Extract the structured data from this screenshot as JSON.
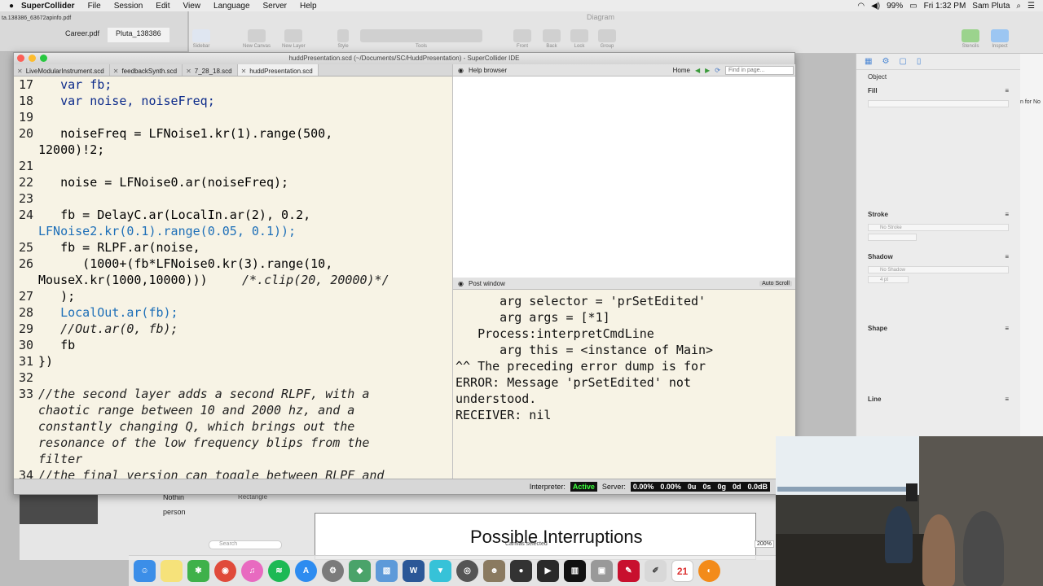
{
  "menubar": {
    "app": "SuperCollider",
    "items": [
      "File",
      "Session",
      "Edit",
      "View",
      "Language",
      "Server",
      "Help"
    ],
    "battery": "99%",
    "clock": "Fri 1:32 PM",
    "user": "Sam Pluta"
  },
  "background": {
    "file_label": "ta.138386_63672apinfo.pdf",
    "tabs": [
      "Career.pdf",
      "Pluta_138386"
    ],
    "diagram_title": "Diagram",
    "tools": [
      "Sidebar",
      "New Canvas",
      "New Layer",
      "Style",
      "Tools",
      "Front",
      "Back",
      "Lock",
      "Group",
      "Stencils",
      "Inspect"
    ],
    "inspector": {
      "object": "Object",
      "fill": "Fill",
      "stroke": "Stroke",
      "no_stroke": "No Stroke",
      "shadow": "Shadow",
      "no_shadow": "No Shadow",
      "shadow_size": "4 pt",
      "shape": "Shape",
      "line": "Line"
    },
    "far_right_text": "n for No",
    "rectangle_label": "Rectangle",
    "lower_left_1": "Nothin",
    "lower_left_2": "person",
    "search_placeholder": "Search",
    "canvas_status": "Canvas selected",
    "zoom": "200%",
    "slide_title": "Possible Interruptions"
  },
  "sc": {
    "window_title": "huddPresentation.scd (~/Documents/SC/HuddPresentation) - SuperCollider IDE",
    "tabs": [
      "LiveModularInstrument.scd",
      "feedbackSynth.scd",
      "7_28_18.scd",
      "huddPresentation.scd"
    ],
    "help_label": "Help browser",
    "help_home": "Home",
    "find_placeholder": "Find in page...",
    "post_label": "Post window",
    "auto_scroll": "Auto Scroll",
    "post_lines": [
      "      arg selector = 'prSetEdited'",
      "      arg args = [*1]",
      "   Process:interpretCmdLine",
      "      arg this = <instance of Main>",
      "^^ The preceding error dump is for",
      "ERROR: Message 'prSetEdited' not",
      "understood.",
      "RECEIVER: nil"
    ],
    "status": {
      "interpreter_label": "Interpreter:",
      "interpreter_state": "Active",
      "server_label": "Server:",
      "server_values": [
        "0.00%",
        "0.00%",
        "0u",
        "0s",
        "0g",
        "0d",
        "0.0dB"
      ]
    },
    "line_numbers": [
      "17",
      "18",
      "19",
      "20",
      "21",
      "22",
      "23",
      "24",
      "25",
      "26",
      "27",
      "28",
      "29",
      "30",
      "31",
      "32",
      "33",
      "34"
    ],
    "code": {
      "l17": "   var fb;",
      "l18": "   var noise, noiseFreq;",
      "l20a": "   noiseFreq = LFNoise1.kr(1).range(500,",
      "l20b": "12000)!2;",
      "l22": "   noise = LFNoise0.ar(noiseFreq);",
      "l24a": "   fb = DelayC.ar(LocalIn.ar(2), 0.2,",
      "l24b": "LFNoise2.kr(0.1).range(0.05, 0.1));",
      "l25": "   fb = RLPF.ar(noise,",
      "l26a": "      (1000+(fb*LFNoise0.kr(3).range(10,",
      "l26b_code": "MouseX.kr(1000,10000)))",
      "l26b_comment": "/*.clip(20, 20000)*/",
      "l27": "   );",
      "l28": "   LocalOut.ar(fb);",
      "l29": "   //Out.ar(0, fb);",
      "l30": "   fb",
      "l31": "})",
      "l33a": "//the second layer adds a second RLPF, with a",
      "l33b": "chaotic range between 10 and 2000 hz, and a",
      "l33c": "constantly changing Q, which brings out the",
      "l33d": "resonance of the low frequency blips from the",
      "l33e": "filter",
      "l34": "//the final version can toggle between RLPF and"
    }
  },
  "dock": {
    "calendar_day": "21",
    "icons": [
      "finder-icon",
      "notes-icon",
      "xcode-icon",
      "chrome-icon",
      "itunes-icon",
      "spotify-icon",
      "appstore-icon",
      "settings-icon",
      "vpn-icon",
      "preview-icon",
      "word-icon",
      "mail-icon",
      "sc-icon",
      "gimp-icon",
      "omnigraffle-icon",
      "terminal-icon",
      "piano-icon",
      "cube-icon",
      "acrobat-icon",
      "pencil-icon",
      "calendar-icon",
      "firefox-icon"
    ]
  },
  "colors": {
    "editor_bg": "#f7f3e5",
    "keyword": "#0b2a8a",
    "class": "#1d6fb8",
    "active_green": "#3cff3c"
  }
}
